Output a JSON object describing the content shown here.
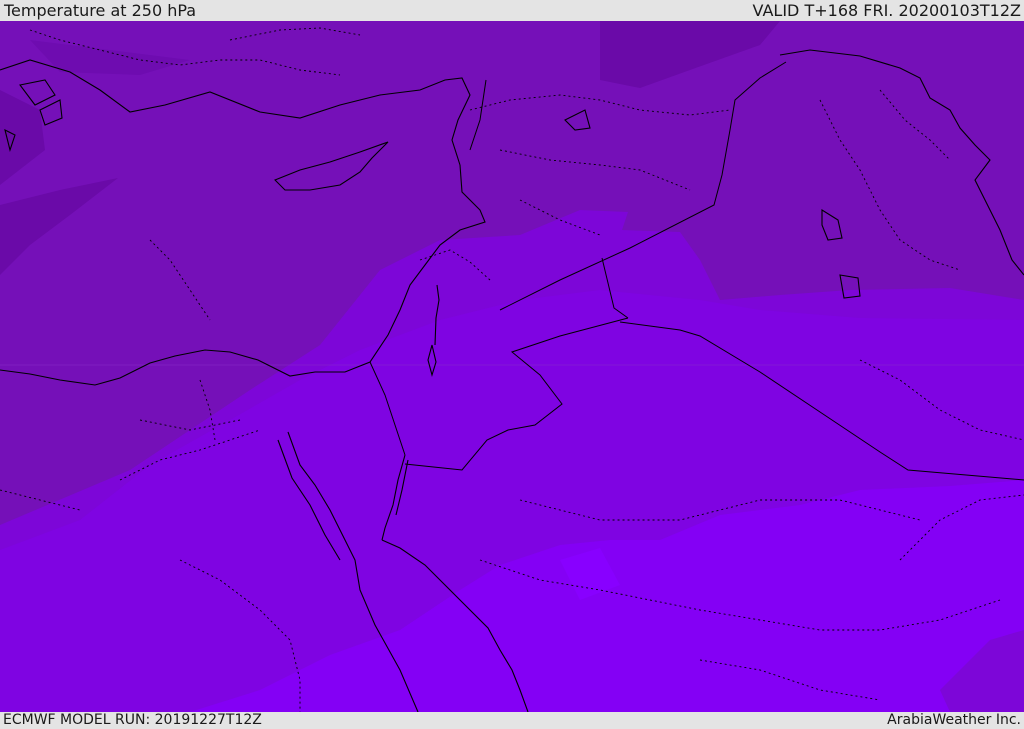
{
  "header": {
    "title": "Temperature at 250 hPa",
    "valid": "VALID T+168 FRI. 20200103T12Z"
  },
  "footer": {
    "model_run": "ECMWF MODEL RUN: 20191227T12Z",
    "credit": "ArabiaWeather Inc."
  },
  "colors": {
    "background_band": "#7510b8",
    "band_dark": "#6a0aa8",
    "band_mid": "#7d06d8",
    "band_light": "#8400f5",
    "band_brightest": "#8800ff",
    "borders": "#000000",
    "header_bg": "#e4e4e4"
  }
}
